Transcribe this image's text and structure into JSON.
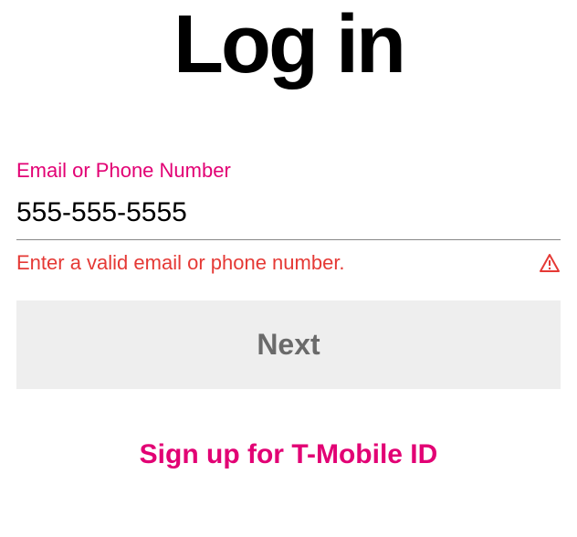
{
  "title": "Log in",
  "form": {
    "field_label": "Email or Phone Number",
    "field_value": "555-555-5555",
    "error_message": "Enter a valid email or phone number.",
    "next_label": "Next"
  },
  "signup": {
    "label": "Sign up for T-Mobile ID"
  },
  "colors": {
    "brand": "#e20074",
    "error": "#e53935"
  }
}
